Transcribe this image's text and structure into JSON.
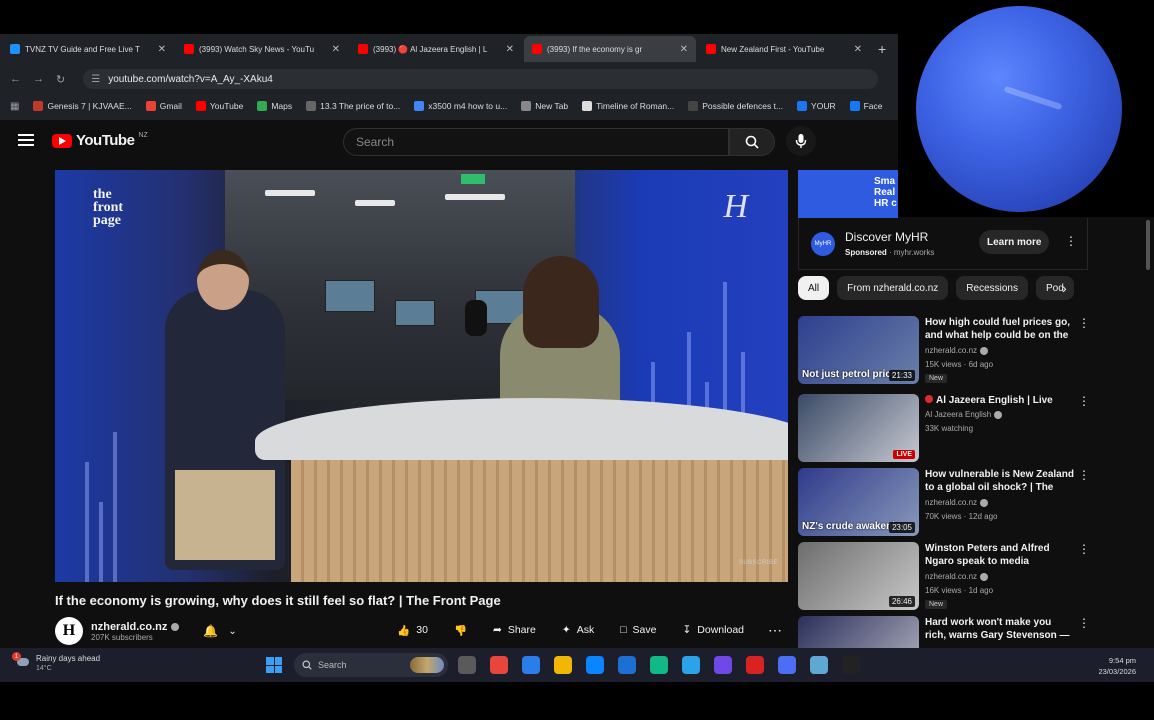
{
  "browser": {
    "tabs": [
      {
        "title": "TVNZ TV Guide and Free Live T",
        "favicon_color": "#1e90ff",
        "active": false
      },
      {
        "title": "(3993) Watch Sky News - YouTu",
        "favicon_color": "#ff0000",
        "active": false
      },
      {
        "title": "(3993) 🔴 Al Jazeera English | L",
        "favicon_color": "#ff0000",
        "active": false
      },
      {
        "title": "(3993) If the economy is gr",
        "favicon_color": "#ff0000",
        "active": true
      },
      {
        "title": "New Zealand First - YouTube",
        "favicon_color": "#ff0000",
        "active": false
      }
    ],
    "new_tab_label": "+",
    "url": "youtube.com/watch?v=A_Ay_-XAku4",
    "bookmarks": [
      {
        "label": "Genesis 7 | KJVAAE...",
        "color": "#c0392b"
      },
      {
        "label": "Gmail",
        "color": "#ea4335"
      },
      {
        "label": "YouTube",
        "color": "#ff0000"
      },
      {
        "label": "Maps",
        "color": "#34a853"
      },
      {
        "label": "13.3 The price of to...",
        "color": "#666666"
      },
      {
        "label": "x3500 m4 how to u...",
        "color": "#4285f4"
      },
      {
        "label": "New Tab",
        "color": "#888888"
      },
      {
        "label": "Timeline of Roman...",
        "color": "#dddddd"
      },
      {
        "label": "Possible defences t...",
        "color": "#444444"
      },
      {
        "label": "YOUR",
        "color": "#1877f2"
      },
      {
        "label": "Face",
        "color": "#1877f2"
      }
    ]
  },
  "youtube": {
    "logo_text": "YouTube",
    "region": "NZ",
    "search_placeholder": "Search",
    "video": {
      "title": "If the economy is growing, why does it still feel so flat? | The Front Page",
      "channel": "nzherald.co.nz",
      "subscribers": "207K subscribers",
      "likes": "30",
      "share_label": "Share",
      "ask_label": "Ask",
      "save_label": "Save",
      "download_label": "Download",
      "brand_left": "the front page",
      "brand_right": "H",
      "watermark": "SUBSCRIBE"
    },
    "ad": {
      "banner_text": "Sma Real HR c",
      "logo_text": "MyHR",
      "title": "Discover MyHR",
      "sponsored": "Sponsored",
      "domain": "myhr.works",
      "cta": "Learn more"
    },
    "chips": [
      "All",
      "From nzherald.co.nz",
      "Recessions",
      "Pod"
    ],
    "recommendations": [
      {
        "title": "How high could fuel prices go, and what help could be on the ...",
        "channel": "nzherald.co.nz",
        "meta": "15K views · 6d ago",
        "duration": "21:33",
        "caption": "Not just petrol prices",
        "new": "New",
        "live": false
      },
      {
        "title": "Al Jazeera English | Live",
        "channel": "Al Jazeera English",
        "meta": "33K watching",
        "duration": "LIVE",
        "caption": "",
        "new": "",
        "live": true
      },
      {
        "title": "How vulnerable is New Zealand to a global oil shock? | The Fro...",
        "channel": "nzherald.co.nz",
        "meta": "70K views · 12d ago",
        "duration": "23:05",
        "caption": "NZ's crude awakening",
        "new": "",
        "live": false
      },
      {
        "title": "Winston Peters and Alfred Ngaro speak to media followin...",
        "channel": "nzherald.co.nz",
        "meta": "16K views · 1d ago",
        "duration": "26:46",
        "caption": "",
        "new": "New",
        "live": false
      },
      {
        "title": "Hard work won't make you rich, warns Gary Stevenson — and ...",
        "channel": "",
        "meta": "",
        "duration": "",
        "caption": "",
        "new": "",
        "live": false
      }
    ]
  },
  "taskbar": {
    "weather_text": "Rainy days ahead",
    "weather_temp": "14°C",
    "weather_badge": "1",
    "search_label": "Search",
    "apps": [
      "#5a5a5a",
      "#e8453c",
      "#2b7de9",
      "#f2b705",
      "#0a84ff",
      "#1d6fd1",
      "#12b886",
      "#2aa3e8",
      "#7048e8",
      "#d92323",
      "#4c6ef5",
      "#5fa8d3",
      "#222222"
    ],
    "time": "9:54 pm",
    "date": "23/03/2026"
  }
}
